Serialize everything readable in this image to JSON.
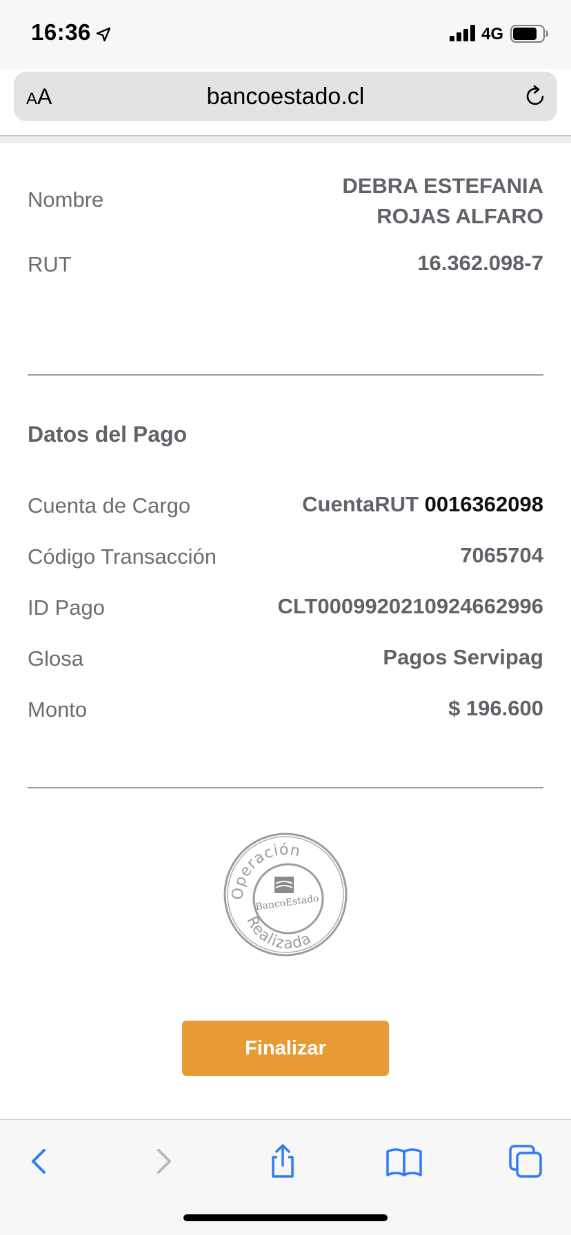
{
  "status_bar": {
    "time": "16:36",
    "network": "4G"
  },
  "browser": {
    "aa_small": "A",
    "aa_large": "A",
    "url": "bancoestado.cl"
  },
  "person": {
    "name_label": "Nombre",
    "name_line1": "DEBRA ESTEFANIA",
    "name_line2": "ROJAS ALFARO",
    "rut_label": "RUT",
    "rut_value": "16.362.098-7"
  },
  "payment": {
    "section_title": "Datos del Pago",
    "account_label": "Cuenta de Cargo",
    "account_type": "CuentaRUT",
    "account_number": "0016362098",
    "transaction_label": "Código Transacción",
    "transaction_value": "7065704",
    "payment_id_label": "ID Pago",
    "payment_id_value": "CLT0009920210924662996",
    "gloss_label": "Glosa",
    "gloss_value": "Pagos Servipag",
    "amount_label": "Monto",
    "amount_value": "$ 196.600"
  },
  "stamp": {
    "top_text": "Operación",
    "logo_text": "BancoEstado",
    "bottom_text": "Realizada"
  },
  "actions": {
    "finalize_label": "Finalizar"
  },
  "colors": {
    "accent": "#e89b35",
    "ios_blue": "#2f7cf6",
    "text_gray": "#5f6368"
  },
  "icons": {
    "back": "chevron-left-icon",
    "forward": "chevron-right-icon",
    "share": "share-icon",
    "bookmarks": "book-icon",
    "tabs": "tabs-icon",
    "reload": "reload-icon"
  }
}
